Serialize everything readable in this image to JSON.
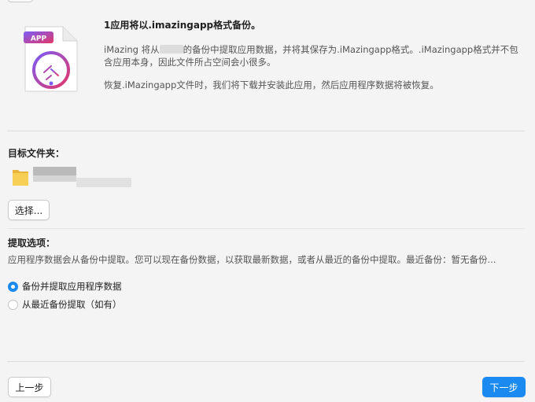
{
  "info": {
    "title": "1应用将以.imazingapp格式备份。",
    "p1_before": "iMazing 将从",
    "p1_after": "的备份中提取应用数据，并将其保存为.iMazingapp格式。.iMazingapp格式并不包含应用本身，因此文件所占空间会小很多。",
    "p2": "恢复.iMazingapp文件时，我们将下载并安装此应用，然后应用程序数据将被恢复。",
    "icon_label": "APP"
  },
  "target": {
    "label": "目标文件夹：",
    "choose_button": "选择..."
  },
  "extract": {
    "label": "提取选项：",
    "description": "应用程序数据会从备份中提取。您可以现在备份数据，以获取最新数据，或者从最近的备份中提取。最近备份：暂无备份...",
    "options": [
      {
        "label": "备份并提取应用程序数据",
        "selected": true
      },
      {
        "label": "从最近备份提取（如有）",
        "selected": false
      }
    ]
  },
  "footer": {
    "prev_button": "上一步",
    "next_button": "下一步"
  },
  "colors": {
    "accent": "#1a8af0",
    "icon_gradient": [
      "#7b5cf5",
      "#e2386a"
    ]
  }
}
